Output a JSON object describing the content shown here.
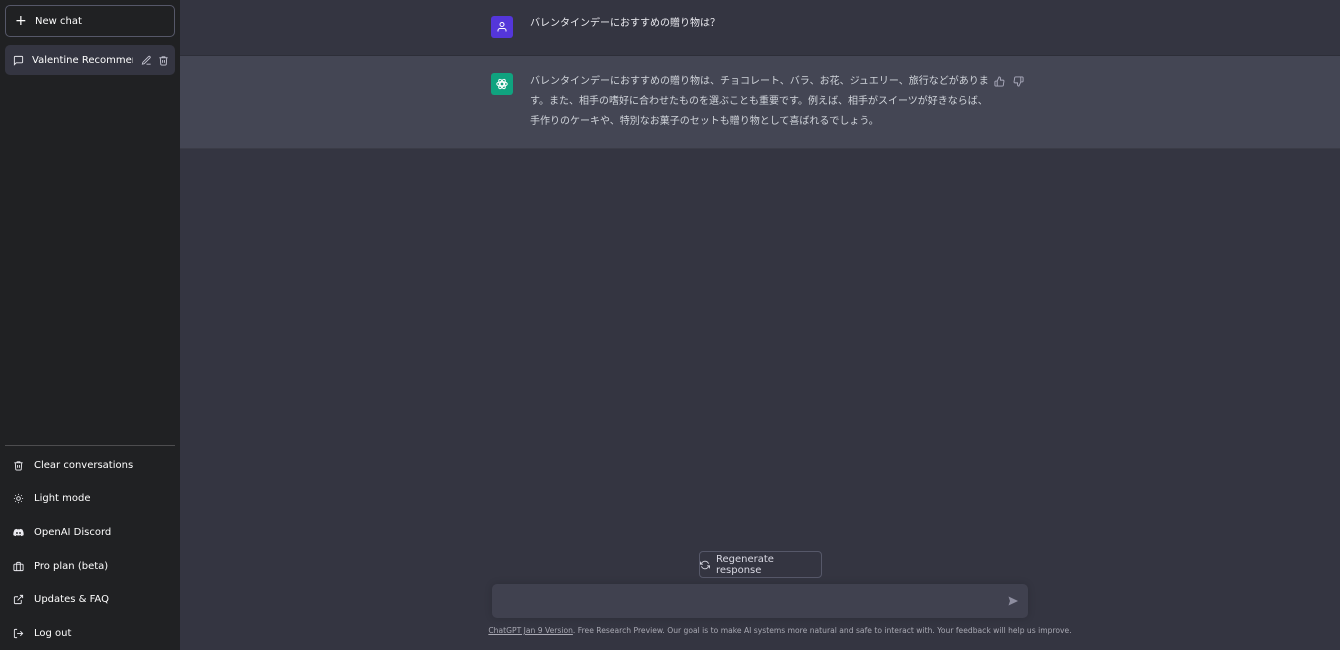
{
  "sidebar": {
    "new_chat_label": "New chat",
    "chats": [
      {
        "label": "Valentine Recommende"
      }
    ],
    "links": [
      {
        "label": "Clear conversations",
        "icon": "trash-icon"
      },
      {
        "label": "Light mode",
        "icon": "sun-icon"
      },
      {
        "label": "OpenAI Discord",
        "icon": "discord-icon"
      },
      {
        "label": "Pro plan (beta)",
        "icon": "briefcase-icon"
      },
      {
        "label": "Updates & FAQ",
        "icon": "external-link-icon"
      },
      {
        "label": "Log out",
        "icon": "logout-icon"
      }
    ]
  },
  "conversation": {
    "user_message": "バレンタインデーにおすすめの贈り物は？",
    "assistant_message": "バレンタインデーにおすすめの贈り物は、チョコレート、バラ、お花、ジュエリー、旅行などがあります。また、相手の嗜好に合わせたものを選ぶことも重要です。例えば、相手がスイーツが好きならば、手作りのケーキや、特別なお菓子のセットも贈り物として喜ばれるでしょう。"
  },
  "composer": {
    "regenerate_label": "Regenerate response",
    "input_value": "",
    "input_placeholder": ""
  },
  "footer": {
    "version_link": "ChatGPT Jan 9 Version",
    "text": ". Free Research Preview. Our goal is to make AI systems more natural and safe to interact with. Your feedback will help us improve."
  },
  "colors": {
    "sidebar_bg": "#202123",
    "main_bg": "#343541",
    "assistant_bg": "#444654",
    "user_avatar": "#5436da",
    "assistant_avatar": "#10a37f"
  }
}
